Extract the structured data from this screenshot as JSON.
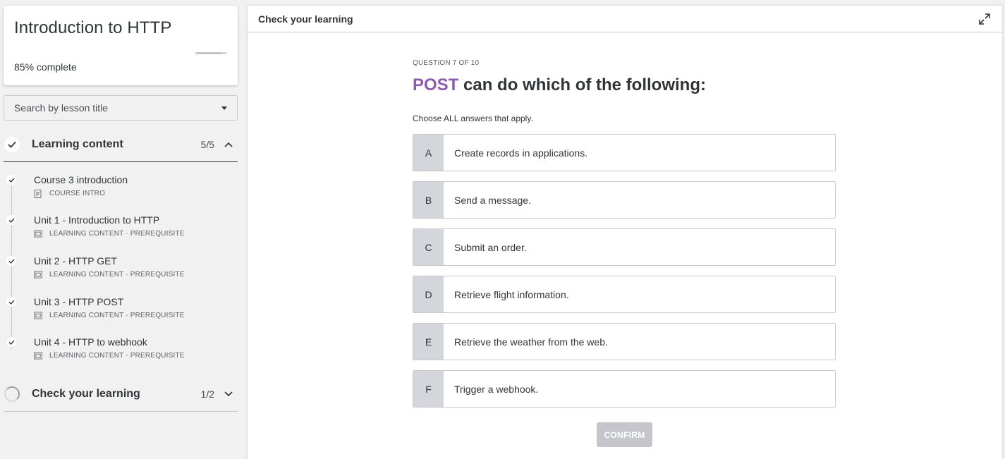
{
  "course": {
    "title": "Introduction to HTTP",
    "progress_percent": 85,
    "progress_pct_label": "85%",
    "progress_suffix": "complete"
  },
  "search": {
    "placeholder": "Search by lesson title"
  },
  "sections": {
    "learning": {
      "title": "Learning content",
      "count": "5/5",
      "expanded": true
    },
    "check": {
      "title": "Check your learning",
      "count": "1/2",
      "expanded": false
    }
  },
  "lessons": [
    {
      "title": "Course 3 introduction",
      "meta": "COURSE INTRO",
      "icon": "document-icon"
    },
    {
      "title": "Unit 1 - Introduction to HTTP",
      "meta": "LEARNING CONTENT · PREREQUISITE",
      "icon": "video-icon"
    },
    {
      "title": "Unit 2 - HTTP GET",
      "meta": "LEARNING CONTENT · PREREQUISITE",
      "icon": "video-icon"
    },
    {
      "title": "Unit 3 - HTTP POST",
      "meta": "LEARNING CONTENT · PREREQUISITE",
      "icon": "video-icon"
    },
    {
      "title": "Unit 4 - HTTP to webhook",
      "meta": "LEARNING CONTENT · PREREQUISITE",
      "icon": "video-icon"
    }
  ],
  "main": {
    "header_title": "Check your learning",
    "question_counter": "QUESTION 7 OF 10",
    "question_keyword": "POST",
    "question_rest": " can do which of the following:",
    "instruction": "Choose ALL answers that apply.",
    "options": [
      {
        "letter": "A",
        "text": "Create records in applications."
      },
      {
        "letter": "B",
        "text": "Send a message."
      },
      {
        "letter": "C",
        "text": "Submit an order."
      },
      {
        "letter": "D",
        "text": "Retrieve flight information."
      },
      {
        "letter": "E",
        "text": "Retrieve the weather from the web."
      },
      {
        "letter": "F",
        "text": "Trigger a webhook."
      }
    ],
    "confirm_label": "CONFIRM"
  },
  "colors": {
    "keyword": "#8e5bb1",
    "option_letter_bg": "#d4d6dc",
    "confirm_bg": "#c4c6cb"
  }
}
